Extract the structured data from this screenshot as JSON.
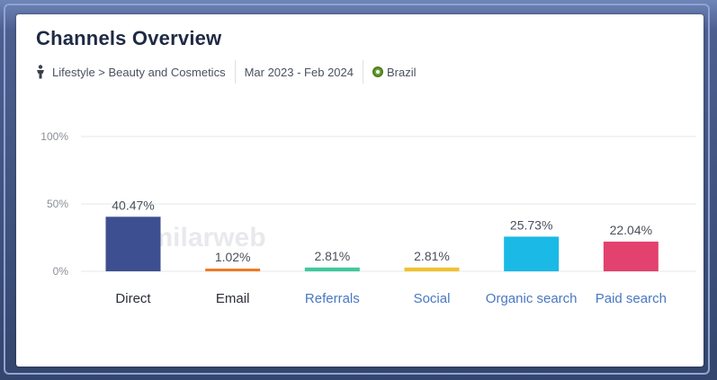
{
  "header": {
    "title": "Channels Overview",
    "category": "Lifestyle > Beauty and Cosmetics",
    "date_range": "Mar 2023 - Feb 2024",
    "country": "Brazil"
  },
  "watermark": "similarweb",
  "colors": {
    "gridline": "#e4e7ec",
    "axis_text": "#8a8f99",
    "value_text": "#4a4f5a",
    "link_text": "#4a78c2",
    "plain_label": "#2b2f38"
  },
  "chart_data": {
    "type": "bar",
    "title": "Channels Overview",
    "ylim": [
      0,
      100
    ],
    "yticks": [
      0,
      50,
      100
    ],
    "ytick_labels": [
      "0%",
      "50%",
      "100%"
    ],
    "grid": true,
    "categories": [
      "Direct",
      "Email",
      "Referrals",
      "Social",
      "Organic search",
      "Paid search"
    ],
    "values": [
      40.47,
      1.02,
      2.81,
      2.81,
      25.73,
      22.04
    ],
    "value_labels": [
      "40.47%",
      "1.02%",
      "2.81%",
      "2.81%",
      "25.73%",
      "22.04%"
    ],
    "bar_colors": [
      "#3e4f91",
      "#f07a22",
      "#3ec99a",
      "#f2c12e",
      "#1ab9e6",
      "#e2426d"
    ],
    "label_is_link": [
      false,
      false,
      true,
      true,
      true,
      true
    ]
  }
}
